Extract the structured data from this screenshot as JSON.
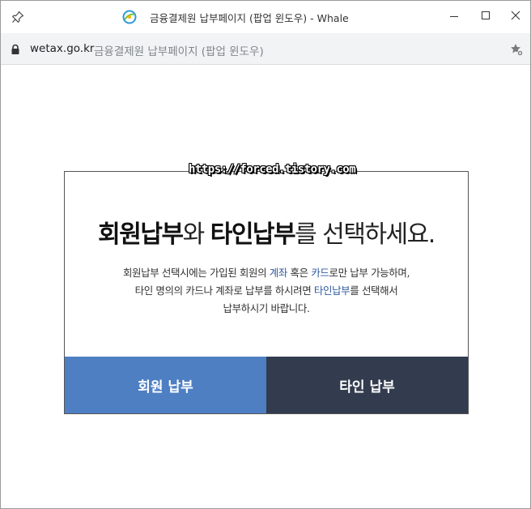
{
  "window": {
    "title": "금융결제원 납부페이지 (팝업 윈도우) - Whale"
  },
  "address_bar": {
    "domain": "wetax.go.kr",
    "page_title": "금융결제원 납부페이지 (팝업 윈도우)"
  },
  "panel": {
    "watermark": "https://forced.tistory.com",
    "headline": {
      "strong1": "회원납부",
      "text1": "와 ",
      "strong2": "타인납부",
      "text2": "를 선택하세요."
    },
    "description": {
      "line1_a": "회원납부 선택시에는 가입된 회원의 ",
      "line1_b": "계좌",
      "line1_c": " 혹은 ",
      "line1_d": "카드",
      "line1_e": "로만 납부 가능하며,",
      "line2_a": "타인 명의의 카드나 계좌로 납부를 하시려면 ",
      "line2_b": "타인납부",
      "line2_c": "를 선택해서",
      "line3": "납부하시기 바랍니다."
    },
    "buttons": {
      "member": "회원 납부",
      "other": "타인 납부"
    }
  },
  "colors": {
    "member_button": "#4e7fc3",
    "other_button": "#323c4e",
    "highlight_text": "#2f5b9e"
  }
}
